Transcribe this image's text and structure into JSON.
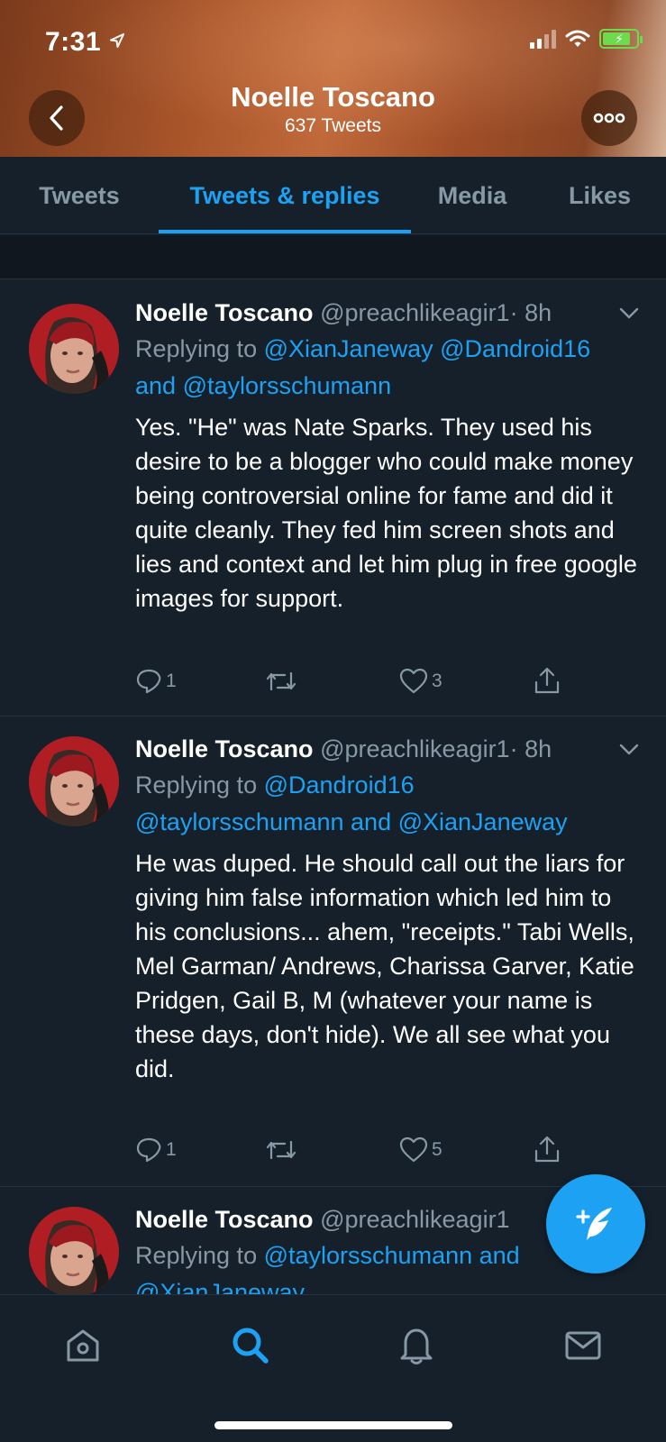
{
  "status_bar": {
    "time": "7:31"
  },
  "header": {
    "name": "Noelle Toscano",
    "tweet_count": "637 Tweets"
  },
  "tabs": [
    {
      "label": "Tweets"
    },
    {
      "label": "Tweets & replies",
      "active": true
    },
    {
      "label": "Media"
    },
    {
      "label": "Likes"
    }
  ],
  "tweets": [
    {
      "name": "Noelle Toscano",
      "handle": "@preachlikeagir1",
      "time": "· 8h",
      "replying_prefix": "Replying to",
      "mentions_line1": "@XianJaneway @Dandroid16",
      "mentions_line2_prefix": "and",
      "mentions_line2": "@taylorsschumann",
      "text": "Yes. \"He\" was Nate Sparks. They used his desire to be a blogger who could make money being controversial online for fame and did it quite cleanly. They fed him screen shots and lies and context and let him plug in free google images for support.",
      "reply_count": "1",
      "retweet_count": "",
      "like_count": "3"
    },
    {
      "name": "Noelle Toscano",
      "handle": "@preachlikeagir1",
      "time": "· 8h",
      "replying_prefix": "Replying to",
      "mentions_line1": "@Dandroid16",
      "mentions_line2": "@taylorsschumann",
      "mentions_line2_mid": "and",
      "mentions_line2_end": "@XianJaneway",
      "text": "He was duped. He should call out the liars for giving him false information which led him to his conclusions... ahem, \"receipts.\" Tabi Wells, Mel Garman/ Andrews, Charissa Garver, Katie Pridgen, Gail B, M (whatever your name is these days, don't hide). We all see what you did.",
      "reply_count": "1",
      "retweet_count": "",
      "like_count": "5"
    },
    {
      "name": "Noelle Toscano",
      "handle": "@preachlikeagir1",
      "replying_prefix": "Replying to",
      "mentions_line1": "@taylorsschumann",
      "mentions_line1_suffix": "and",
      "mentions_line2": "@XianJaneway"
    }
  ],
  "bottom_nav": [
    {
      "icon": "home-icon"
    },
    {
      "icon": "search-icon",
      "active": true
    },
    {
      "icon": "bell-icon"
    },
    {
      "icon": "mail-icon"
    }
  ],
  "colors": {
    "background": "#15202b",
    "accent": "#1da1f2",
    "secondary_text": "#8899a6"
  }
}
